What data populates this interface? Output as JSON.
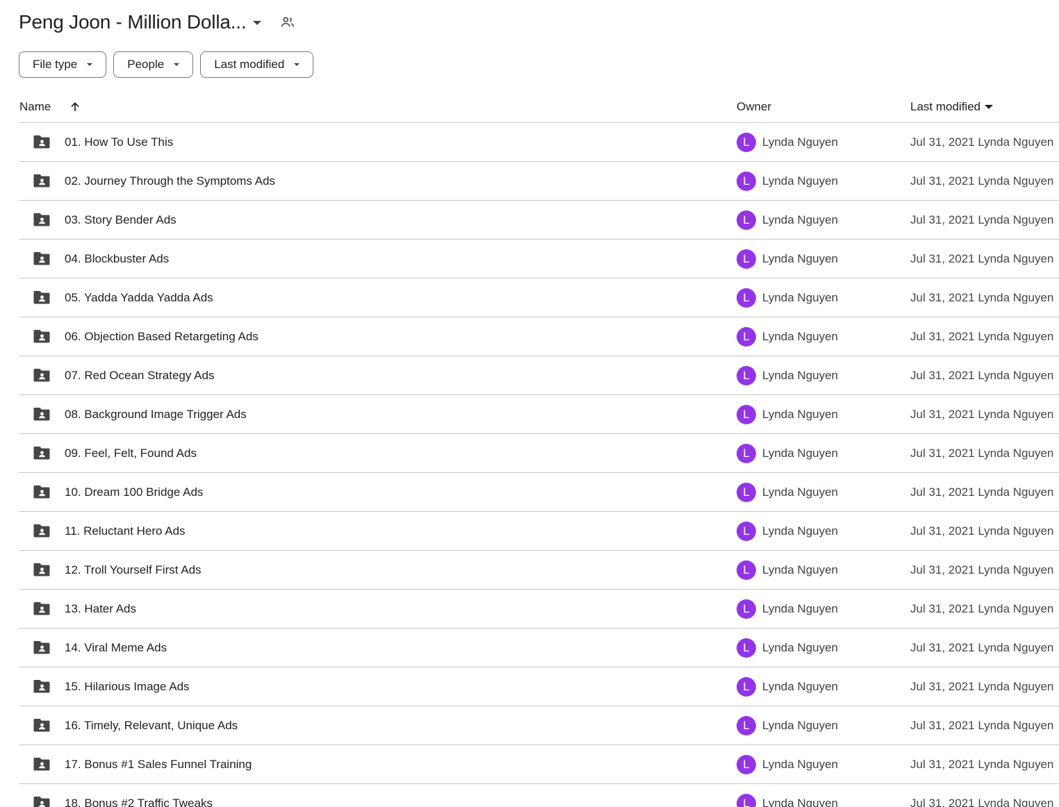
{
  "header": {
    "title": "Peng Joon - Million Dolla...",
    "shared_icon": "people-outline-icon"
  },
  "filters": [
    {
      "label": "File type"
    },
    {
      "label": "People"
    },
    {
      "label": "Last modified"
    }
  ],
  "columns": {
    "name": "Name",
    "owner": "Owner",
    "modified": "Last modified",
    "sort_icon": "arrow-up-icon"
  },
  "colors": {
    "avatar": "#9334e6",
    "icon": "#444746",
    "divider": "#c7c7c7"
  },
  "rows": [
    {
      "name": "01. How To Use This",
      "owner_initial": "L",
      "owner": "Lynda Nguyen",
      "modified": "Jul 31, 2021 Lynda Nguyen"
    },
    {
      "name": "02. Journey Through the Symptoms Ads",
      "owner_initial": "L",
      "owner": "Lynda Nguyen",
      "modified": "Jul 31, 2021 Lynda Nguyen"
    },
    {
      "name": "03. Story Bender Ads",
      "owner_initial": "L",
      "owner": "Lynda Nguyen",
      "modified": "Jul 31, 2021 Lynda Nguyen"
    },
    {
      "name": "04. Blockbuster Ads",
      "owner_initial": "L",
      "owner": "Lynda Nguyen",
      "modified": "Jul 31, 2021 Lynda Nguyen"
    },
    {
      "name": "05. Yadda Yadda Yadda Ads",
      "owner_initial": "L",
      "owner": "Lynda Nguyen",
      "modified": "Jul 31, 2021 Lynda Nguyen"
    },
    {
      "name": "06. Objection Based Retargeting Ads",
      "owner_initial": "L",
      "owner": "Lynda Nguyen",
      "modified": "Jul 31, 2021 Lynda Nguyen"
    },
    {
      "name": "07. Red Ocean Strategy Ads",
      "owner_initial": "L",
      "owner": "Lynda Nguyen",
      "modified": "Jul 31, 2021 Lynda Nguyen"
    },
    {
      "name": "08. Background Image Trigger Ads",
      "owner_initial": "L",
      "owner": "Lynda Nguyen",
      "modified": "Jul 31, 2021 Lynda Nguyen"
    },
    {
      "name": "09. Feel, Felt, Found Ads",
      "owner_initial": "L",
      "owner": "Lynda Nguyen",
      "modified": "Jul 31, 2021 Lynda Nguyen"
    },
    {
      "name": "10. Dream 100 Bridge Ads",
      "owner_initial": "L",
      "owner": "Lynda Nguyen",
      "modified": "Jul 31, 2021 Lynda Nguyen"
    },
    {
      "name": "11. Reluctant Hero Ads",
      "owner_initial": "L",
      "owner": "Lynda Nguyen",
      "modified": "Jul 31, 2021 Lynda Nguyen"
    },
    {
      "name": "12. Troll Yourself First Ads",
      "owner_initial": "L",
      "owner": "Lynda Nguyen",
      "modified": "Jul 31, 2021 Lynda Nguyen"
    },
    {
      "name": "13. Hater Ads",
      "owner_initial": "L",
      "owner": "Lynda Nguyen",
      "modified": "Jul 31, 2021 Lynda Nguyen"
    },
    {
      "name": "14. Viral Meme Ads",
      "owner_initial": "L",
      "owner": "Lynda Nguyen",
      "modified": "Jul 31, 2021 Lynda Nguyen"
    },
    {
      "name": "15. Hilarious Image Ads",
      "owner_initial": "L",
      "owner": "Lynda Nguyen",
      "modified": "Jul 31, 2021 Lynda Nguyen"
    },
    {
      "name": "16. Timely, Relevant, Unique Ads",
      "owner_initial": "L",
      "owner": "Lynda Nguyen",
      "modified": "Jul 31, 2021 Lynda Nguyen"
    },
    {
      "name": "17. Bonus #1 Sales Funnel Training",
      "owner_initial": "L",
      "owner": "Lynda Nguyen",
      "modified": "Jul 31, 2021 Lynda Nguyen"
    },
    {
      "name": "18. Bonus #2 Traffic Tweaks",
      "owner_initial": "L",
      "owner": "Lynda Nguyen",
      "modified": "Jul 31, 2021 Lynda Nguyen"
    }
  ]
}
